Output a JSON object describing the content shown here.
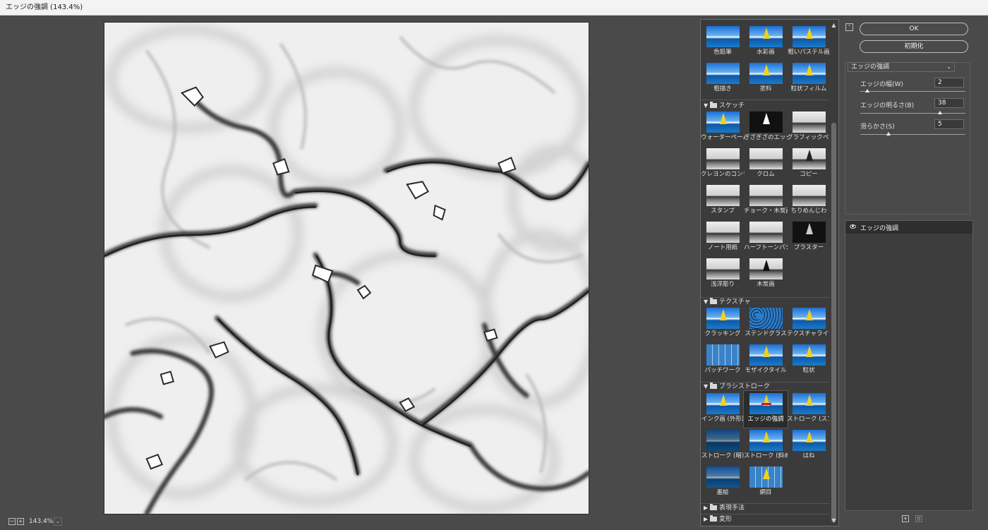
{
  "window": {
    "title": "エッジの強調 (143.4%)"
  },
  "zoom": {
    "minus": "−",
    "plus": "+",
    "value": "143.4%",
    "caret": "⌄"
  },
  "gallery": {
    "scroll_up": "▲",
    "scroll_down": "▼",
    "categories": [
      {
        "name": "スケッチ",
        "open": "▼"
      },
      {
        "name": "テクスチャ",
        "open": "▼"
      },
      {
        "name": "ブラシストローク",
        "open": "▼"
      },
      {
        "name": "表現手法",
        "open": "▶"
      },
      {
        "name": "変形",
        "open": "▶"
      }
    ],
    "art_filters": [
      "色鉛筆",
      "水彩画",
      "粗いパステル画",
      "粗描き",
      "塗料",
      "粒状フィルム"
    ],
    "sketch_filters": [
      "ウォーターペーパー",
      "ぎざぎざのエッジ",
      "グラフィックペン",
      "クレヨンのコンテ画",
      "クロム",
      "コピー",
      "スタンプ",
      "チョーク・木炭画",
      "ちりめんじわ",
      "ノート用紙",
      "ハーフトーンパターン",
      "プラスター",
      "浅浮彫り",
      "木炭画"
    ],
    "texture_filters": [
      "クラッキング",
      "ステンドグラス",
      "テクスチャライザー",
      "パッチワーク",
      "モザイクタイル",
      "粒状"
    ],
    "brush_filters": [
      "インク画 (外形)",
      "エッジの強調",
      "ストローク (スプレー)",
      "ストローク (暗)",
      "ストローク (斜め)",
      "はね",
      "墨絵",
      "網目"
    ]
  },
  "settings": {
    "collapse": "⌃",
    "ok_label": "OK",
    "reset_label": "初期化",
    "filter_selected": "エッジの強調",
    "filter_caret": "⌄",
    "params": [
      {
        "label": "エッジの幅(W)",
        "value": "2",
        "fraction": 0.07
      },
      {
        "label": "エッジの明るさ(B)",
        "value": "38",
        "fraction": 0.76
      },
      {
        "label": "滑らかさ(S)",
        "value": "5",
        "fraction": 0.27
      }
    ]
  },
  "layers": {
    "items": [
      {
        "name": "エッジの強調"
      }
    ],
    "new_label": "+",
    "delete_label": "🗑"
  }
}
